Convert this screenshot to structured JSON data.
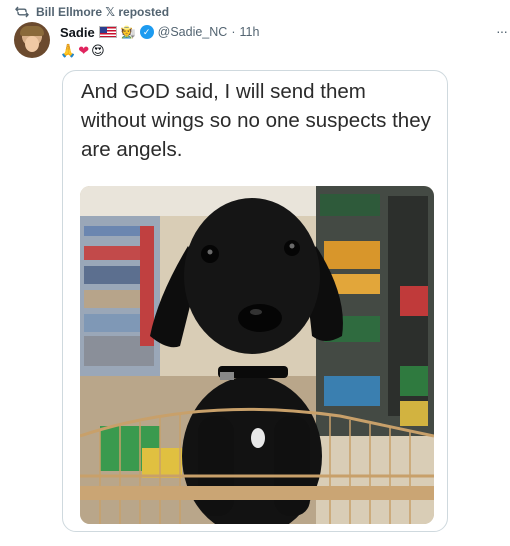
{
  "repost": {
    "icon": "repost-icon",
    "text": "Bill Ellmore 𝕏 reposted"
  },
  "tweet": {
    "author_name": "Sadie",
    "flag_icon": "us-flag-icon",
    "badge_emoji": "🧑‍🌾",
    "verified_icon": "verified-badge-icon",
    "handle": "@Sadie_NC",
    "separator": "·",
    "time": "11h",
    "more_icon": "more-options-icon",
    "emojis": [
      "🙏",
      "❤",
      "😍"
    ]
  },
  "media": {
    "caption": "And GOD said, I will send them without wings so no one suspects they are angels.",
    "photo_subject": "black-puppy-in-shopping-cart"
  },
  "colors": {
    "text_primary": "#0f1419",
    "text_secondary": "#536471",
    "verified": "#1d9bf0",
    "border": "#cfd9de"
  }
}
